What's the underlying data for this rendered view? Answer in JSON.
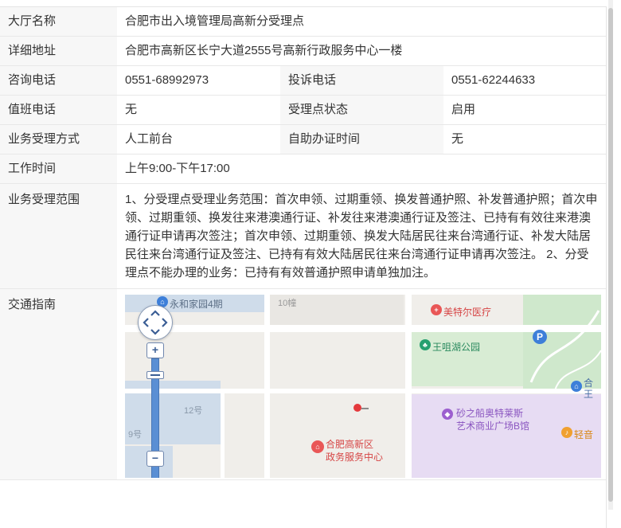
{
  "rows": {
    "hall_name": {
      "label": "大厅名称",
      "value": "合肥市出入境管理局高新分受理点"
    },
    "address": {
      "label": "详细地址",
      "value": "合肥市高新区长宁大道2555号高新行政服务中心一楼"
    },
    "consult": {
      "label": "咨询电话",
      "value": "0551-68992973",
      "sub_label": "投诉电话",
      "sub_value": "0551-62244633"
    },
    "duty": {
      "label": "值班电话",
      "value": "无",
      "sub_label": "受理点状态",
      "sub_value": "启用"
    },
    "method": {
      "label": "业务受理方式",
      "value": "人工前台",
      "sub_label": "自助办证时间",
      "sub_value": "无"
    },
    "hours": {
      "label": "工作时间",
      "value": "上午9:00-下午17:00"
    },
    "scope": {
      "label": "业务受理范围",
      "value": "1、分受理点受理业务范围：首次申领、过期重领、换发普通护照、补发普通护照；首次申领、过期重领、换发往来港澳通行证、补发往来港澳通行证及签注、已持有有效往来港澳通行证申请再次签注；首次申领、过期重领、换发大陆居民往来台湾通行证、补发大陆居民往来台湾通行证及签注、已持有有效大陆居民往来台湾通行证申请再次签注。 2、分受理点不能办理的业务：已持有有效普通护照申请单独加注。"
    },
    "traffic": {
      "label": "交通指南"
    }
  },
  "map": {
    "pois": {
      "yonghe": "永和家园4期",
      "building10": "10幢",
      "meiteer": "美特尔医疗",
      "wangzuihu": "王咀湖公园",
      "building12": "12号",
      "building9": "9号",
      "center_line1": "合肥高新区",
      "center_line2": "政务服务中心",
      "shazhichuan_line1": "砂之船奥特莱斯",
      "shazhichuan_line2": "艺术商业广场B馆",
      "qingyin": "轻音",
      "he_cut": "合",
      "wang_cut": "王"
    },
    "zoom_in": "+",
    "zoom_out": "−",
    "parking": "P",
    "colors": {
      "water": "#cfdcea",
      "park": "#cfe8cc",
      "mall": "#e7dcf3",
      "center": "#e95757",
      "purple": "#9c5fcf",
      "green": "#27a070",
      "blue": "#3d7fd9",
      "orange": "#f0a030"
    }
  }
}
